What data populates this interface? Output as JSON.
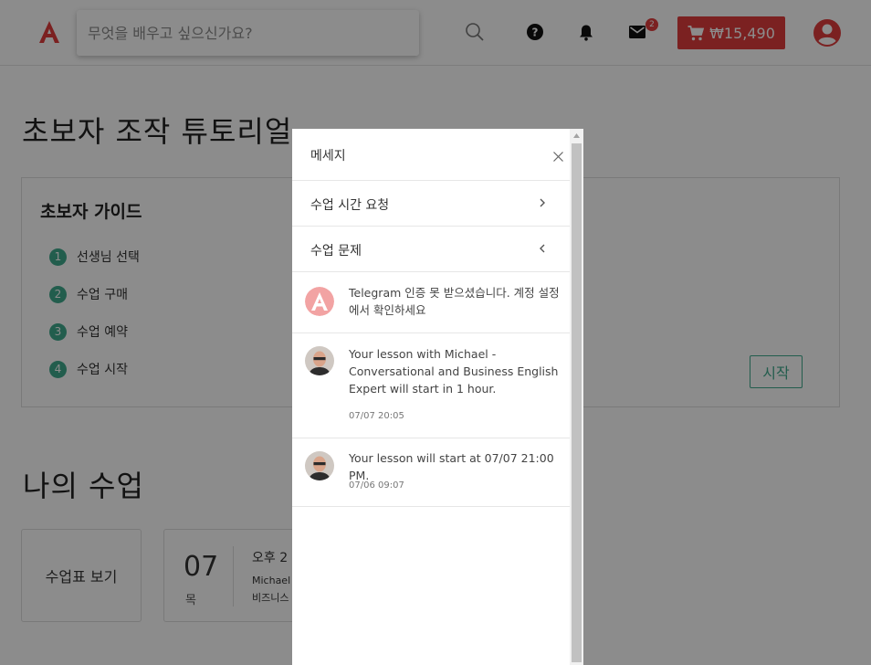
{
  "header": {
    "search_placeholder": "무엇을 배우고 싶으신가요?",
    "mail_badge": "2",
    "cart_total": "₩15,490"
  },
  "tutorial": {
    "title": "초보자 조작 튜토리얼",
    "guide_title": "초보자 가이드",
    "steps": [
      {
        "num": "1",
        "label": "선생님 선택"
      },
      {
        "num": "2",
        "label": "수업 구매"
      },
      {
        "num": "3",
        "label": "수업 예약"
      },
      {
        "num": "4",
        "label": "수업 시작"
      }
    ],
    "start_label": "시작"
  },
  "my_lessons": {
    "title": "나의 수업",
    "schedule_label": "수업표 보기",
    "card": {
      "day": "07",
      "dow": "목",
      "time": "오후 2",
      "teacher": "Michael",
      "course": "비즈니스"
    }
  },
  "messages": {
    "title": "메세지",
    "rows": [
      {
        "label": "수업 시간 요청",
        "chevron": "›"
      },
      {
        "label": "수업 문제",
        "chevron": "‹"
      }
    ],
    "notices": [
      {
        "text": "Telegram 인증 못 받으셨습니다. 계정 설정에서 확인하세요",
        "time": ""
      },
      {
        "text": "Your lesson with Michael - Conversational and Business English Expert will start in 1 hour.",
        "time": "07/07 20:05"
      },
      {
        "text": "Your lesson will start at 07/07 21:00 PM.",
        "time": "07/06 09:07"
      }
    ]
  },
  "colors": {
    "brand_red": "#e03c3c",
    "accent_green": "#3fa98d"
  }
}
